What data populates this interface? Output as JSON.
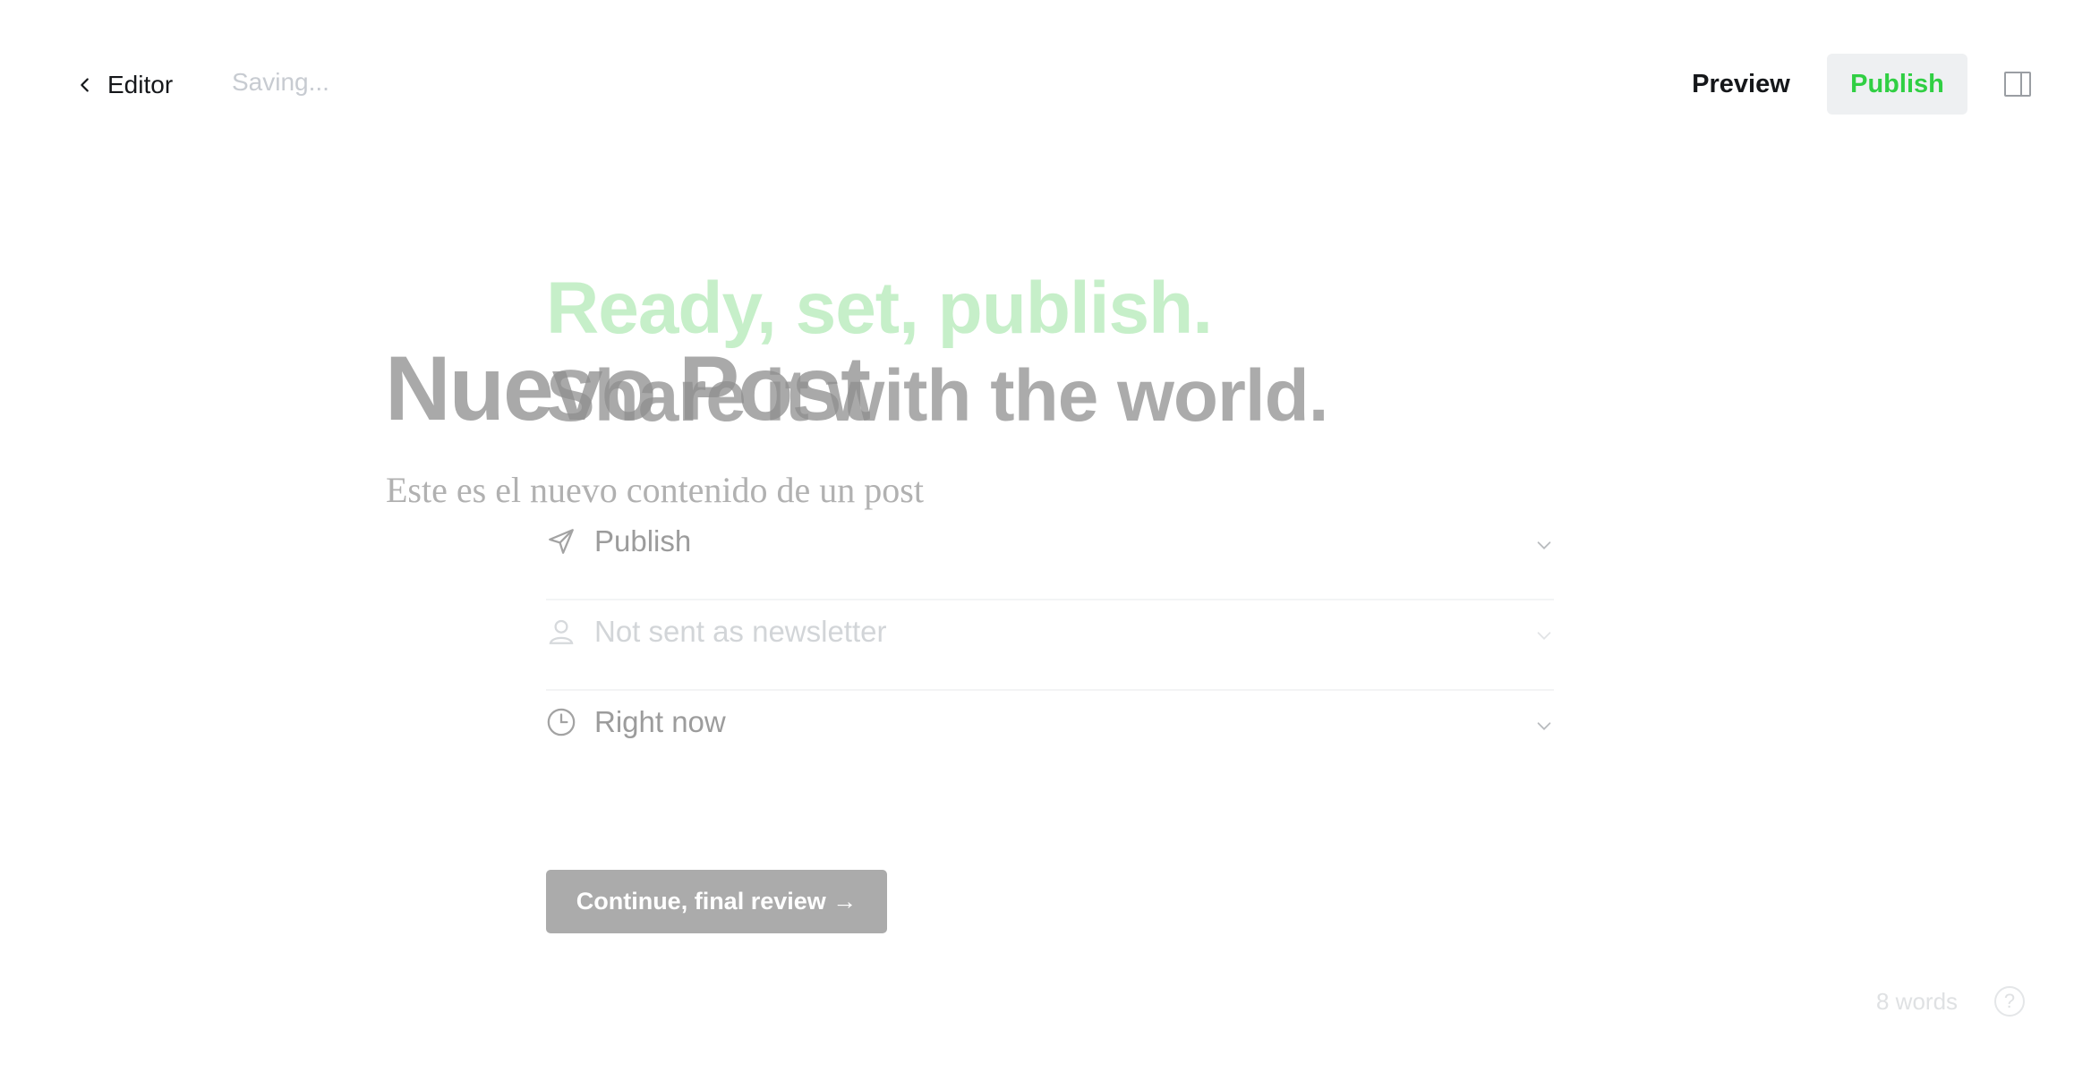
{
  "topbar": {
    "back_label": "Editor",
    "status": "Saving...",
    "preview_label": "Preview",
    "publish_label": "Publish"
  },
  "post": {
    "title": "Nuevo Post",
    "body": "Este es el nuevo contenido de un post"
  },
  "publish_flow": {
    "heading_line1": "Ready, set, publish.",
    "heading_line2": "Share it with the world.",
    "settings": [
      {
        "icon": "send-icon",
        "label": "Publish"
      },
      {
        "icon": "user-icon",
        "label": "Not sent as newsletter"
      },
      {
        "icon": "clock-icon",
        "label": "Right now"
      }
    ],
    "continue_label": "Continue, final review →"
  },
  "footer": {
    "word_count": "8 words",
    "help_label": "?"
  },
  "colors": {
    "accent_green": "#30cf43",
    "heading_green": "#c6efc9"
  }
}
